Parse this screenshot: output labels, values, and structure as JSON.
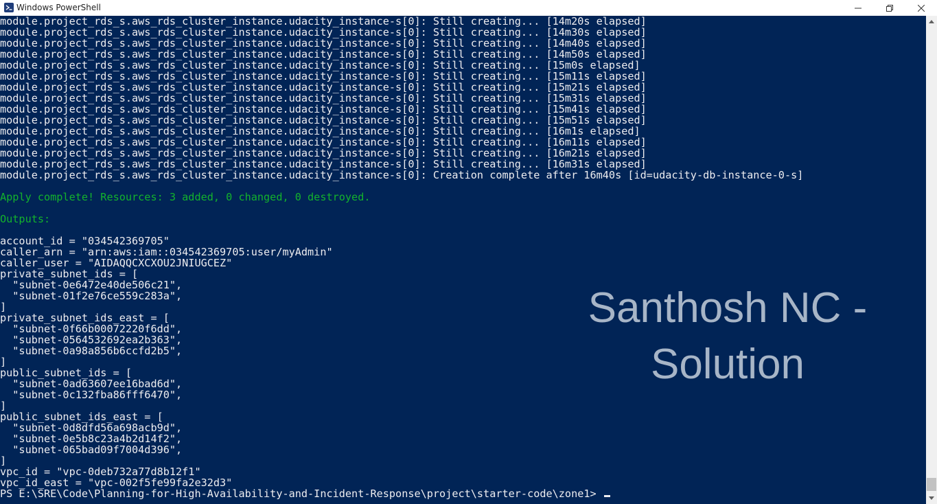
{
  "window": {
    "title": "Windows PowerShell",
    "minimize_glyph": "—",
    "maximize_glyph": "❐",
    "close_glyph": "✕"
  },
  "colors": {
    "console_background": "#012456",
    "console_text": "#eeedf0",
    "success_text": "#13b32c",
    "watermark_text": "#a7b5c7"
  },
  "console": {
    "lines": [
      {
        "text": "module.project_rds_s.aws_rds_cluster_instance.udacity_instance-s[0]: Still creating... [14m20s elapsed]",
        "style": "normal"
      },
      {
        "text": "module.project_rds_s.aws_rds_cluster_instance.udacity_instance-s[0]: Still creating... [14m30s elapsed]",
        "style": "normal"
      },
      {
        "text": "module.project_rds_s.aws_rds_cluster_instance.udacity_instance-s[0]: Still creating... [14m40s elapsed]",
        "style": "normal"
      },
      {
        "text": "module.project_rds_s.aws_rds_cluster_instance.udacity_instance-s[0]: Still creating... [14m50s elapsed]",
        "style": "normal"
      },
      {
        "text": "module.project_rds_s.aws_rds_cluster_instance.udacity_instance-s[0]: Still creating... [15m0s elapsed]",
        "style": "normal"
      },
      {
        "text": "module.project_rds_s.aws_rds_cluster_instance.udacity_instance-s[0]: Still creating... [15m11s elapsed]",
        "style": "normal"
      },
      {
        "text": "module.project_rds_s.aws_rds_cluster_instance.udacity_instance-s[0]: Still creating... [15m21s elapsed]",
        "style": "normal"
      },
      {
        "text": "module.project_rds_s.aws_rds_cluster_instance.udacity_instance-s[0]: Still creating... [15m31s elapsed]",
        "style": "normal"
      },
      {
        "text": "module.project_rds_s.aws_rds_cluster_instance.udacity_instance-s[0]: Still creating... [15m41s elapsed]",
        "style": "normal"
      },
      {
        "text": "module.project_rds_s.aws_rds_cluster_instance.udacity_instance-s[0]: Still creating... [15m51s elapsed]",
        "style": "normal"
      },
      {
        "text": "module.project_rds_s.aws_rds_cluster_instance.udacity_instance-s[0]: Still creating... [16m1s elapsed]",
        "style": "normal"
      },
      {
        "text": "module.project_rds_s.aws_rds_cluster_instance.udacity_instance-s[0]: Still creating... [16m11s elapsed]",
        "style": "normal"
      },
      {
        "text": "module.project_rds_s.aws_rds_cluster_instance.udacity_instance-s[0]: Still creating... [16m21s elapsed]",
        "style": "normal"
      },
      {
        "text": "module.project_rds_s.aws_rds_cluster_instance.udacity_instance-s[0]: Still creating... [16m31s elapsed]",
        "style": "normal"
      },
      {
        "text": "module.project_rds_s.aws_rds_cluster_instance.udacity_instance-s[0]: Creation complete after 16m40s [id=udacity-db-instance-0-s]",
        "style": "normal"
      },
      {
        "text": "",
        "style": "normal"
      },
      {
        "text": "Apply complete! Resources: 3 added, 0 changed, 0 destroyed.",
        "style": "green"
      },
      {
        "text": "",
        "style": "normal"
      },
      {
        "text": "Outputs:",
        "style": "green"
      },
      {
        "text": "",
        "style": "normal"
      },
      {
        "text": "account_id = \"034542369705\"",
        "style": "normal"
      },
      {
        "text": "caller_arn = \"arn:aws:iam::034542369705:user/myAdmin\"",
        "style": "normal"
      },
      {
        "text": "caller_user = \"AIDAQQCXCXOU2JNIUGCEZ\"",
        "style": "normal"
      },
      {
        "text": "private_subnet_ids = [",
        "style": "normal"
      },
      {
        "text": "  \"subnet-0e6472e40de506c21\",",
        "style": "normal"
      },
      {
        "text": "  \"subnet-01f2e76ce559c283a\",",
        "style": "normal"
      },
      {
        "text": "]",
        "style": "normal"
      },
      {
        "text": "private_subnet_ids_east = [",
        "style": "normal"
      },
      {
        "text": "  \"subnet-0f66b00072220f6dd\",",
        "style": "normal"
      },
      {
        "text": "  \"subnet-0564532692ea2b363\",",
        "style": "normal"
      },
      {
        "text": "  \"subnet-0a98a856b6ccfd2b5\",",
        "style": "normal"
      },
      {
        "text": "]",
        "style": "normal"
      },
      {
        "text": "public_subnet_ids = [",
        "style": "normal"
      },
      {
        "text": "  \"subnet-0ad63607ee16bad6d\",",
        "style": "normal"
      },
      {
        "text": "  \"subnet-0c132fba86fff6470\",",
        "style": "normal"
      },
      {
        "text": "]",
        "style": "normal"
      },
      {
        "text": "public_subnet_ids_east = [",
        "style": "normal"
      },
      {
        "text": "  \"subnet-0d8dfd56a698acb9d\",",
        "style": "normal"
      },
      {
        "text": "  \"subnet-0e5b8c23a4b2d14f2\",",
        "style": "normal"
      },
      {
        "text": "  \"subnet-065bad09f7004d396\",",
        "style": "normal"
      },
      {
        "text": "]",
        "style": "normal"
      },
      {
        "text": "vpc_id = \"vpc-0deb732a77d8b12f1\"",
        "style": "normal"
      },
      {
        "text": "vpc_id_east = \"vpc-002f5fe99fa2e32d3\"",
        "style": "normal"
      }
    ],
    "prompt": "PS E:\\SRE\\Code\\Planning-for-High-Availability-and-Incident-Response\\project\\starter-code\\zone1> "
  },
  "watermark": {
    "line1": "Santhosh NC -",
    "line2": "Solution"
  },
  "scrollbar": {
    "position": 1.0
  },
  "icons": {
    "app": "powershell-icon",
    "minimize": "minimize-icon",
    "maximize": "restore-icon",
    "close": "close-icon",
    "scroll_up": "scroll-up-arrow-icon",
    "scroll_down": "scroll-down-arrow-icon"
  }
}
